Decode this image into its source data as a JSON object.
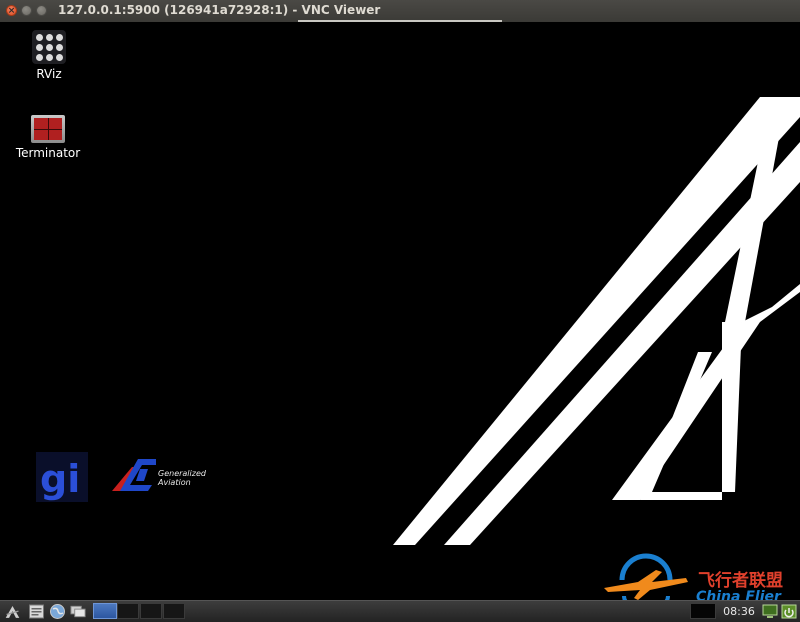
{
  "window": {
    "title": "127.0.0.1:5900 (126941a72928:1) - VNC Viewer"
  },
  "desktop": {
    "icons": [
      {
        "label": "RViz",
        "icon": "rviz-icon"
      },
      {
        "label": "Terminator",
        "icon": "terminator-icon"
      }
    ],
    "wallpaper_logo_text": [
      "Generalized",
      "Aviation"
    ]
  },
  "watermark": {
    "chinese": "飞行者联盟",
    "english": "China Flier"
  },
  "taskbar": {
    "clock": "08:36",
    "launchers": [
      "start-menu-icon",
      "file-manager-icon",
      "web-browser-icon",
      "show-desktop-icon"
    ]
  },
  "colors": {
    "desktop_bg": "#000000",
    "titlebar_bg": "#3b3a36",
    "active_task": "#3a66b0",
    "watermark_red": "#e0402c",
    "watermark_blue": "#1a7fd0"
  }
}
